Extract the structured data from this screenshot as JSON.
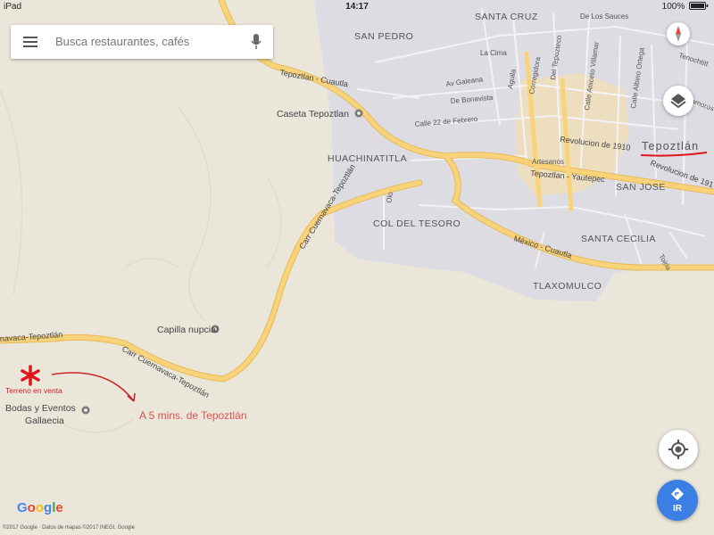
{
  "status_bar": {
    "carrier": "iPad",
    "time": "14:17",
    "battery": "100%"
  },
  "search": {
    "placeholder": "Busca restaurantes, cafés"
  },
  "map": {
    "neighborhoods": [
      "SANTA CRUZ",
      "SAN PEDRO",
      "HUACHINATITLA",
      "COL DEL TESORO",
      "SAN JOSE",
      "SANTA CECILIA",
      "TLAXOMULCO"
    ],
    "streets": [
      "De Los Sauces",
      "Tenochtitl",
      "La Cima",
      "Aguila",
      "Corregidora",
      "Del Tepozteco",
      "Av Galeana",
      "Calle Aniceto Villamar",
      "Calle Albino Ortega",
      "Tamoros",
      "De Bonavista",
      "Calle 22 de Febrero",
      "Revolucion de 1910",
      "Revolucion de 191",
      "Artesanos",
      "Tepoztlan - Yautepec",
      "México - Cuautla",
      "Tepoztlan - Cuautla",
      "Carr Cuernavaca-Tepoztlán",
      "Carr Cuernavaca-Tepoztlán",
      "navaca-Tepoztlán",
      "Olo",
      "Toiria"
    ],
    "pois": [
      "Caseta Tepoztlan",
      "Capilla nupcial",
      "Bodas y Eventos",
      "Gallaecia"
    ],
    "city_label": "Tepoztlán",
    "annotations": {
      "lot_label": "Terreno en venta",
      "distance_note": "A 5 mins. de Tepoztlán"
    }
  },
  "controls": {
    "go_label": "IR"
  },
  "branding": {
    "logo": "Google",
    "attribution": "©2017 Google · Datos de mapas ©2017 INEGI, Google"
  },
  "colors": {
    "land": "#ebe6da",
    "urban": "#dcdce2",
    "road_major": "#f7cf6a",
    "road_minor": "#ffffff",
    "downtown": "#f6dfb0",
    "annotation": "#e0141b",
    "go_button": "#3b7ee4"
  }
}
